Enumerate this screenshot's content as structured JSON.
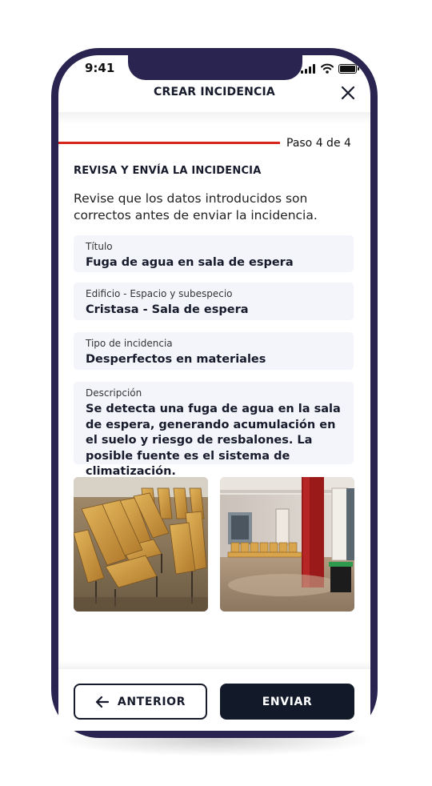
{
  "status_bar": {
    "time": "9:41"
  },
  "header": {
    "title": "CREAR INCIDENCIA"
  },
  "progress": {
    "step_label": "Paso 4 de 4",
    "current_step": 4,
    "total_steps": 4
  },
  "review": {
    "title": "REVISA Y ENVÍA LA INCIDENCIA",
    "intro": "Revise que los datos introducidos son correctos antes de enviar la incidencia."
  },
  "fields": [
    {
      "label": "Título",
      "value": "Fuga de agua en sala de espera"
    },
    {
      "label": "Edificio - Espacio y subespecio",
      "value": "Cristasa - Sala de espera"
    },
    {
      "label": "Tipo de incidencia",
      "value": "Desperfectos en materiales"
    },
    {
      "label": "Descripción",
      "value": "Se detecta una fuga de agua en la sala de espera, generando acumulación en el suelo y riesgo de resbalones. La posible fuente es el sistema de climatización."
    }
  ],
  "actions": {
    "previous_label": "ANTERIOR",
    "send_label": "ENVIAR"
  },
  "colors": {
    "accent_red": "#d7261e",
    "dark_navy": "#121a2a",
    "phone_frame": "#2a2450",
    "field_bg": "#f4f5fb"
  },
  "icons": {
    "close": "close-icon",
    "back": "arrow-left-icon"
  }
}
